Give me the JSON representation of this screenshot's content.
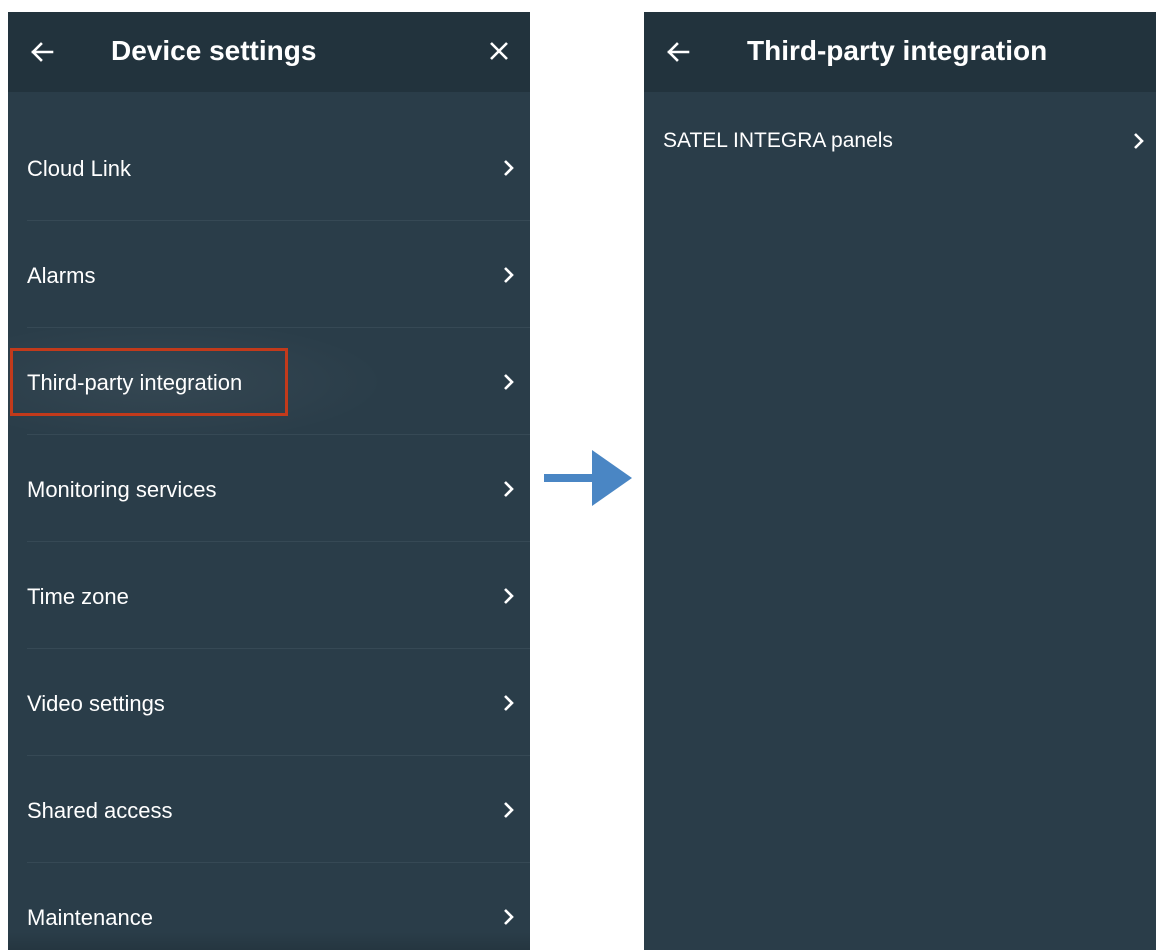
{
  "device_settings": {
    "title": "Device settings",
    "back_icon": "arrow-left-icon",
    "close_icon": "close-icon",
    "items": [
      {
        "label": "Cloud Link",
        "icon": "chevron-right-icon"
      },
      {
        "label": "Alarms",
        "icon": "chevron-right-icon"
      },
      {
        "label": "Third-party integration",
        "icon": "chevron-right-icon",
        "highlighted": true
      },
      {
        "label": "Monitoring services",
        "icon": "chevron-right-icon"
      },
      {
        "label": "Time zone",
        "icon": "chevron-right-icon"
      },
      {
        "label": "Video settings",
        "icon": "chevron-right-icon"
      },
      {
        "label": "Shared access",
        "icon": "chevron-right-icon"
      },
      {
        "label": "Maintenance",
        "icon": "chevron-right-icon"
      }
    ]
  },
  "third_party_integration": {
    "title": "Third-party integration",
    "back_icon": "arrow-left-icon",
    "items": [
      {
        "label": "SATEL INTEGRA panels",
        "icon": "chevron-right-icon"
      }
    ]
  },
  "flow_arrow": {
    "icon": "arrow-right-icon",
    "color": "#4a86c4"
  },
  "colors": {
    "panel_background": "#2a3d49",
    "appbar_background": "#22333d",
    "highlight_border": "#c23a1b",
    "text": "#ffffff"
  }
}
